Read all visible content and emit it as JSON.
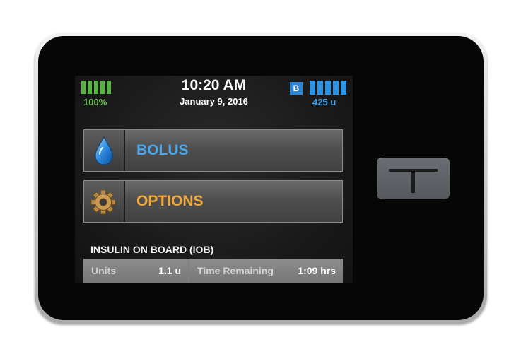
{
  "status": {
    "battery_percent": 100,
    "battery_label": "100%",
    "time": "10:20 AM",
    "date": "January 9, 2016",
    "bluetooth_badge": "B",
    "insulin_level_fraction": 1.0,
    "insulin_label": "425 u"
  },
  "menu": {
    "bolus": {
      "label": "BOLUS",
      "icon": "water-drop-icon",
      "color": "#4aa8ee"
    },
    "options": {
      "label": "OPTIONS",
      "icon": "gear-icon",
      "color": "#f0a93a"
    }
  },
  "iob": {
    "title": "INSULIN ON BOARD (IOB)",
    "units_label": "Units",
    "units_value": "1.1 u",
    "time_label": "Time Remaining",
    "time_value": "1:09 hrs"
  },
  "hardware": {
    "button_icon": "t-logo-icon"
  }
}
